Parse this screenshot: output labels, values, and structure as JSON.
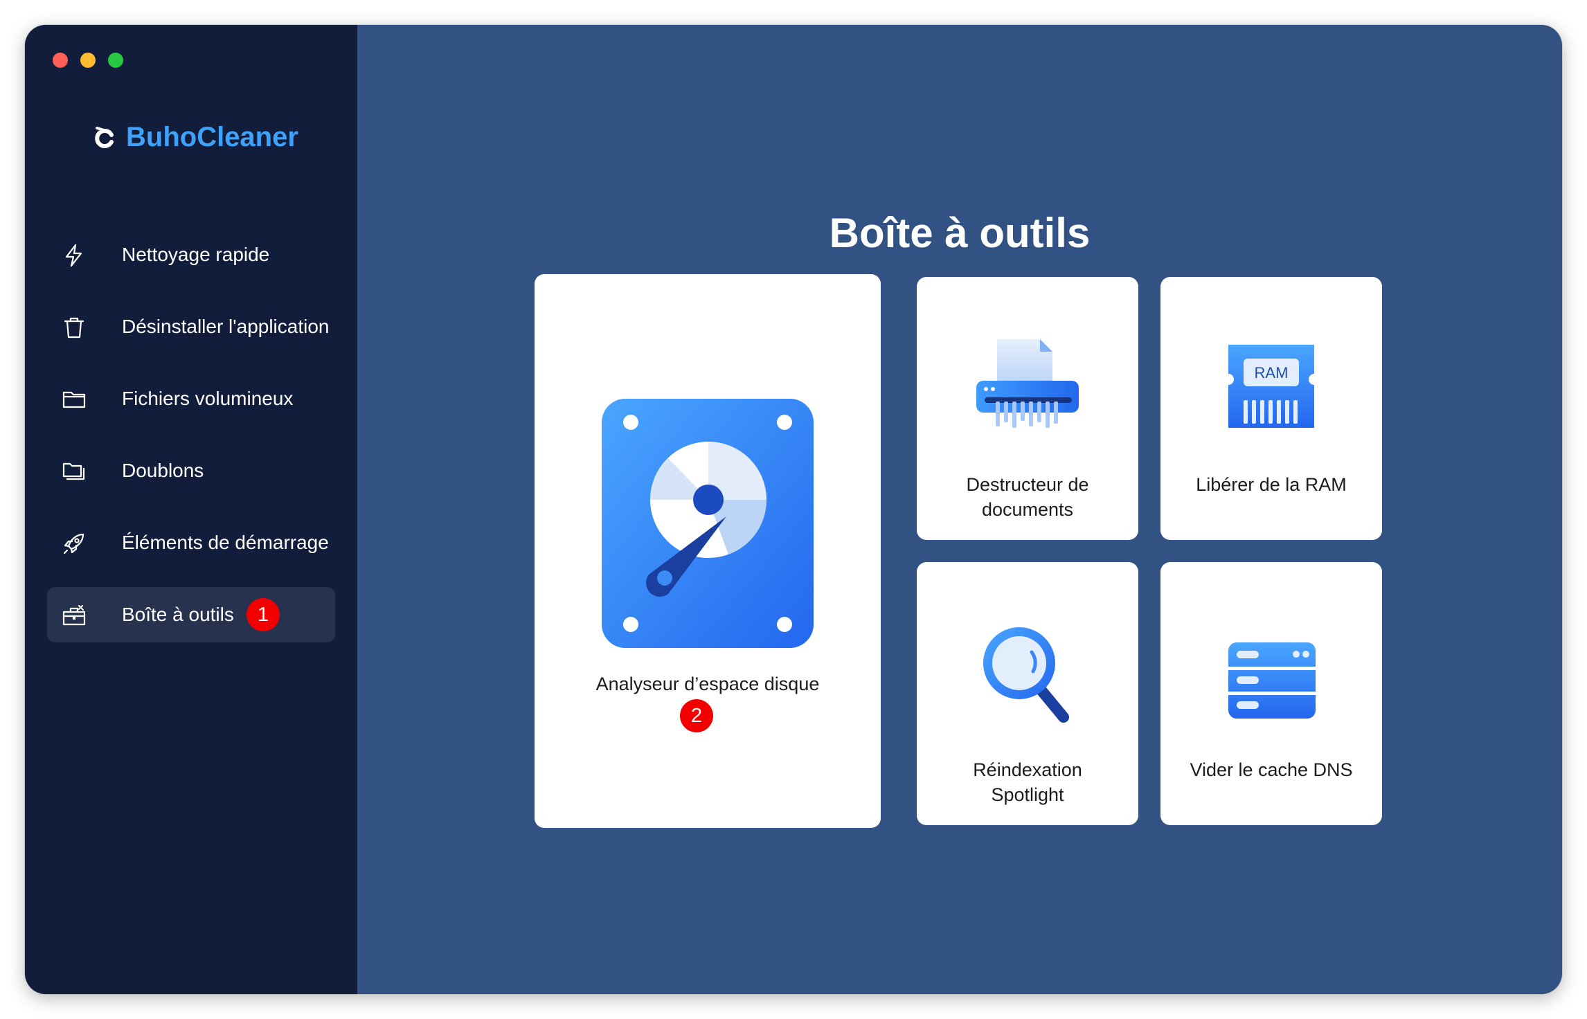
{
  "app": {
    "name": "BuhoCleaner",
    "colors": {
      "brand": "#3ea2fb",
      "sidebar_bg": "#121d3b",
      "main_bg": "#335284",
      "active_item_bg": "#27324f",
      "badge": "#f20000",
      "card_bg": "#ffffff"
    }
  },
  "window_controls": [
    "close",
    "minimize",
    "zoom"
  ],
  "sidebar": {
    "items": [
      {
        "label": "Nettoyage rapide",
        "icon": "lightning-icon",
        "active": false
      },
      {
        "label": "Désinstaller l'application",
        "icon": "trash-icon",
        "active": false
      },
      {
        "label": "Fichiers volumineux",
        "icon": "folder-icon",
        "active": false
      },
      {
        "label": "Doublons",
        "icon": "duplicate-folders-icon",
        "active": false
      },
      {
        "label": "Éléments de démarrage",
        "icon": "rocket-icon",
        "active": false
      },
      {
        "label": "Boîte à outils",
        "icon": "toolbox-icon",
        "active": true,
        "badge": "1"
      }
    ]
  },
  "main": {
    "title": "Boîte à outils",
    "tools": [
      {
        "label": "Analyseur d’espace disque",
        "icon": "disk-analyzer-icon",
        "badge": "2"
      },
      {
        "label": "Destructeur de documents",
        "icon": "shredder-icon"
      },
      {
        "label": "Libérer de la RAM",
        "icon": "ram-icon",
        "icon_text": "RAM"
      },
      {
        "label": "Réindexation Spotlight",
        "icon": "magnifier-icon"
      },
      {
        "label": "Vider le cache DNS",
        "icon": "dns-server-icon"
      }
    ]
  }
}
